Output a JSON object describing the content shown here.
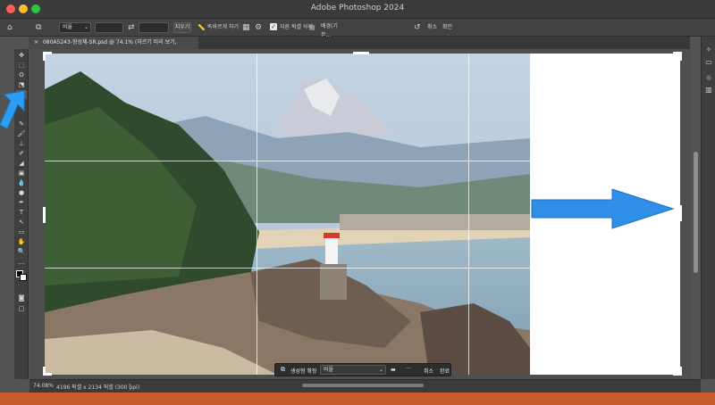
{
  "window": {
    "title": "Adobe Photoshop 2024",
    "traffic_lights": [
      "#ff5f57",
      "#febc2e",
      "#28c840"
    ]
  },
  "options_bar": {
    "ratio_value": "비율",
    "clear_label": "지우기",
    "straighten_label": "똑바르게 하기",
    "delete_cropped_label": "자른 픽셀 삭제",
    "fill_value": "배경(기본...",
    "cancel_label": "취소",
    "commit_label": "확인"
  },
  "document": {
    "tab_title": "080A5243-항상체-SR.psd @ 74.1% (자르기 미리 보기, RGB/8*) *"
  },
  "context_bar": {
    "generative_expand_label": "생성형 확장",
    "ratio_value": "비율",
    "more_label": "···",
    "cancel_label": "취소",
    "done_label": "완료"
  },
  "status_bar": {
    "zoom": "74.08%",
    "doc_info": "4196 픽셀 x 2134 픽셀 (300 ppi)"
  },
  "colors": {
    "accent_blue": "#2a9df4",
    "arrow_blue": "#2f8fe8"
  },
  "icons": {
    "home": "home-icon",
    "crop": "crop-icon",
    "swap": "swap-icon",
    "grid": "grid-overlay-icon",
    "gear": "gear-icon",
    "undo": "undo-icon",
    "generative": "generative-expand-icon",
    "chevron": "chevron-down-icon"
  }
}
